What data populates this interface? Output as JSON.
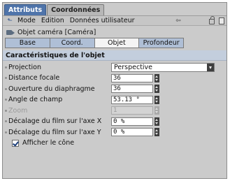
{
  "window_tabs": [
    {
      "label": "Attributs",
      "active": true
    },
    {
      "label": "Coordonnées",
      "active": false
    }
  ],
  "menu": {
    "items": [
      "Mode",
      "Edition",
      "Données utilisateur"
    ]
  },
  "object": {
    "title": "Objet caméra [Caméra]"
  },
  "sub_tabs": [
    {
      "label": "Base",
      "active": false
    },
    {
      "label": "Coord.",
      "active": false
    },
    {
      "label": "Objet",
      "active": true
    },
    {
      "label": "Profondeur",
      "active": false
    }
  ],
  "section": {
    "title": "Caractéristiques de l'objet"
  },
  "fields": {
    "projection": {
      "label": "Projection",
      "value": "Perspective"
    },
    "focal": {
      "label": "Distance focale",
      "value": "36"
    },
    "aperture": {
      "label": "Ouverture du diaphragme",
      "value": "36"
    },
    "fov": {
      "label": "Angle de champ",
      "value": "53.13 °"
    },
    "zoom": {
      "label": "Zoom",
      "value": "1"
    },
    "film_x": {
      "label": "Décalage du film sur l'axe X",
      "value": "0 %"
    },
    "film_y": {
      "label": "Décalage du film sur l'axe Y",
      "value": "0 %"
    },
    "show_cone": {
      "label": "Afficher le cône",
      "checked": true
    }
  },
  "colors": {
    "active_tab": "#4f74aa",
    "sub_tab": "#afbfd6",
    "section_header": "#c3cedd",
    "panel": "#cbcbcb"
  }
}
